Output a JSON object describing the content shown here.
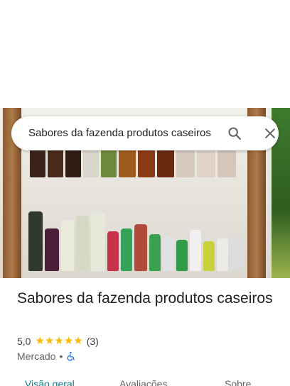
{
  "search": {
    "query": "Sabores da fazenda produtos caseiros"
  },
  "place": {
    "name": "Sabores da fazenda produtos caseiros",
    "rating": "5,0",
    "stars": 5,
    "review_count": "(3)",
    "category": "Mercado",
    "separator": "•"
  },
  "tabs": [
    {
      "label": "Visão geral",
      "active": true
    },
    {
      "label": "Avaliações",
      "active": false
    },
    {
      "label": "Sobre",
      "active": false
    }
  ],
  "colors": {
    "accent": "#0b7a8c",
    "star": "#fbbc04",
    "accessibility": "#1a73e8"
  },
  "icons": [
    "search-icon",
    "close-icon",
    "star-icon",
    "wheelchair-accessible-icon"
  ]
}
